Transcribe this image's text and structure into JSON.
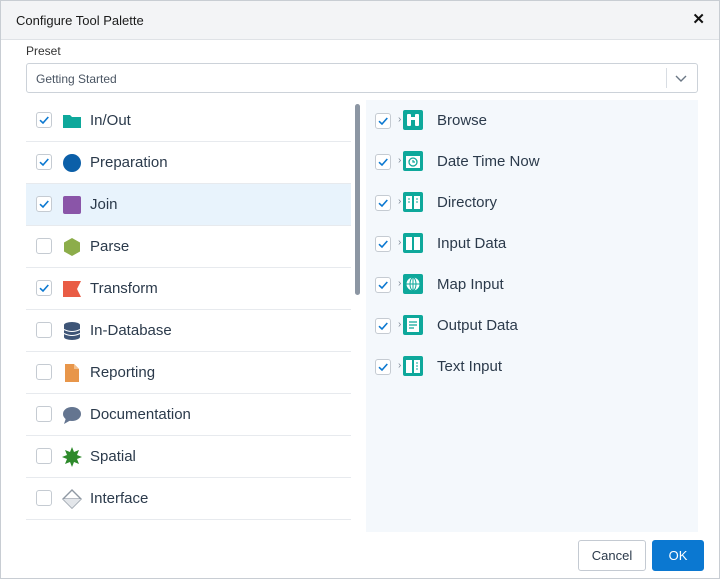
{
  "dialog": {
    "title": "Configure Tool Palette",
    "close_glyph": "✕"
  },
  "preset": {
    "label": "Preset",
    "value": "Getting Started"
  },
  "categories": [
    {
      "label": "In/Out",
      "checked": true,
      "selected": false,
      "icon": "folder-icon",
      "color": "#0ea89b"
    },
    {
      "label": "Preparation",
      "checked": true,
      "selected": false,
      "icon": "circle-icon",
      "color": "#0b5fa8"
    },
    {
      "label": "Join",
      "checked": true,
      "selected": true,
      "icon": "square-icon",
      "color": "#8a55a8"
    },
    {
      "label": "Parse",
      "checked": false,
      "selected": false,
      "icon": "hexagon-icon",
      "color": "#8cad4a"
    },
    {
      "label": "Transform",
      "checked": true,
      "selected": false,
      "icon": "ribbon-icon",
      "color": "#e95c45"
    },
    {
      "label": "In-Database",
      "checked": false,
      "selected": false,
      "icon": "database-icon",
      "color": "#3e5577"
    },
    {
      "label": "Reporting",
      "checked": false,
      "selected": false,
      "icon": "document-icon",
      "color": "#e8964a"
    },
    {
      "label": "Documentation",
      "checked": false,
      "selected": false,
      "icon": "speech-bubble-icon",
      "color": "#647590"
    },
    {
      "label": "Spatial",
      "checked": false,
      "selected": false,
      "icon": "starburst-icon",
      "color": "#2e8a2b"
    },
    {
      "label": "Interface",
      "checked": false,
      "selected": false,
      "icon": "diamond-icon",
      "color": "#8f98a3"
    }
  ],
  "tools": [
    {
      "label": "Browse",
      "checked": true,
      "icon": "binoculars-icon"
    },
    {
      "label": "Date Time Now",
      "checked": true,
      "icon": "clock-folder-icon"
    },
    {
      "label": "Directory",
      "checked": true,
      "icon": "directory-book-icon"
    },
    {
      "label": "Input Data",
      "checked": true,
      "icon": "book-input-icon"
    },
    {
      "label": "Map Input",
      "checked": true,
      "icon": "globe-icon"
    },
    {
      "label": "Output Data",
      "checked": true,
      "icon": "output-document-icon"
    },
    {
      "label": "Text Input",
      "checked": true,
      "icon": "book-text-icon"
    }
  ],
  "tool_color": "#0ea89b",
  "check_color": "#0b78d1",
  "buttons": {
    "cancel": "Cancel",
    "ok": "OK"
  }
}
